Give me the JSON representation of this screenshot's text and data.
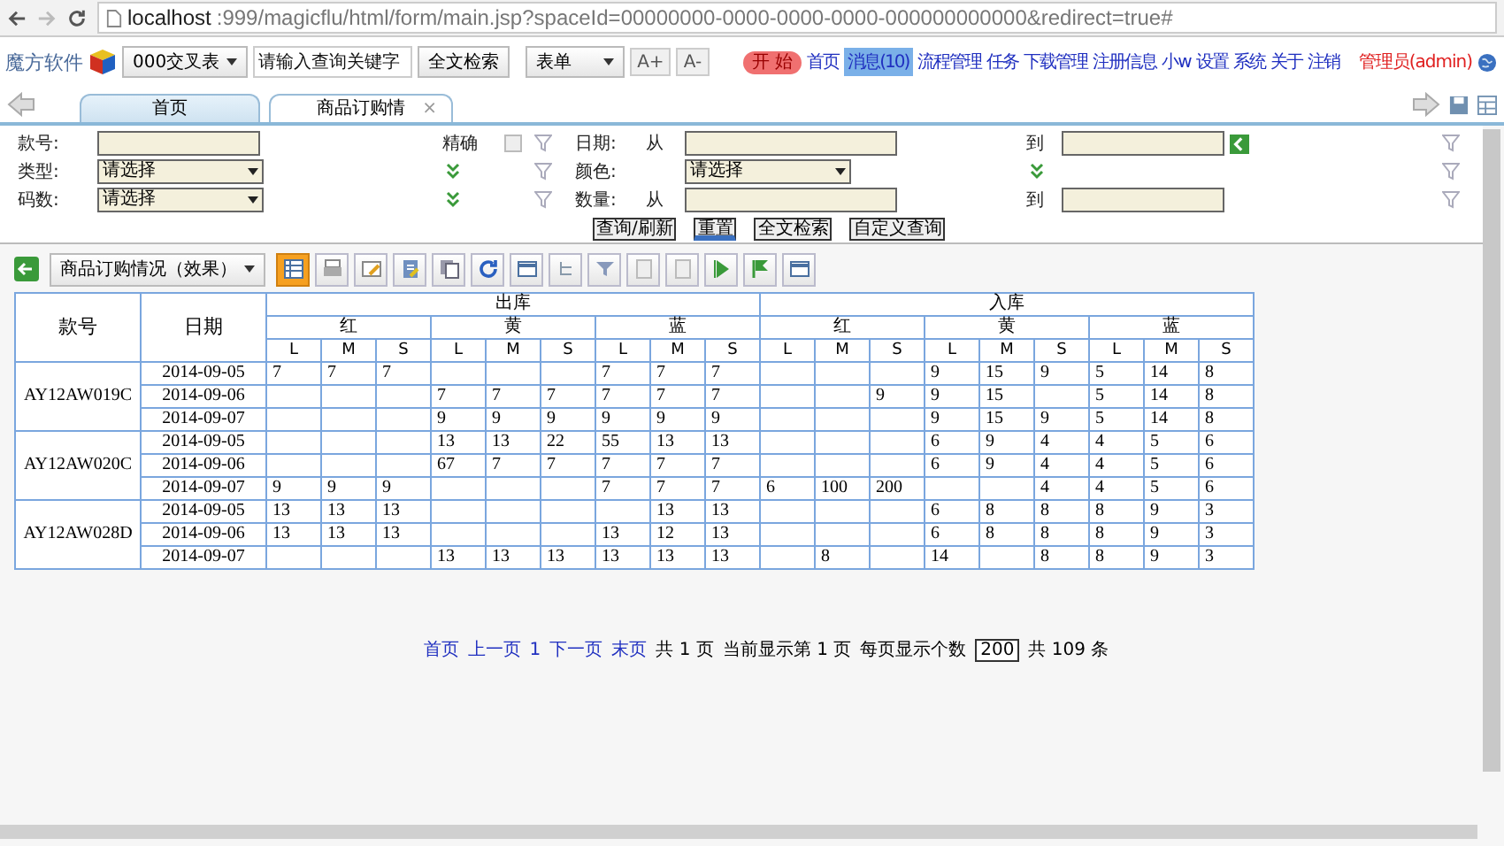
{
  "browser": {
    "host": "localhost",
    "path": ":999/magicflu/html/form/main.jsp?spaceId=00000000-0000-0000-0000-000000000000&redirect=true#"
  },
  "header": {
    "logo": "魔方软件",
    "space_select": "000交叉表",
    "search_placeholder": "请输入查询关键字",
    "search_button": "全文检索",
    "form_select": "表单",
    "font_buttons": [
      "A+",
      "A-"
    ],
    "start_button": "开 始",
    "nav": [
      {
        "label": "首页",
        "highlighted": false
      },
      {
        "label": "消息(10)",
        "highlighted": true
      },
      {
        "label": "流程管理",
        "highlighted": false
      },
      {
        "label": "任务",
        "highlighted": false
      },
      {
        "label": "下载管理",
        "highlighted": false
      },
      {
        "label": "注册信息",
        "highlighted": false
      },
      {
        "label": "小w",
        "highlighted": false
      },
      {
        "label": "设置",
        "highlighted": false
      },
      {
        "label": "系统",
        "highlighted": false
      },
      {
        "label": "关于",
        "highlighted": false
      },
      {
        "label": "注销",
        "highlighted": false
      }
    ],
    "user": "管理员(admin)"
  },
  "tabs": [
    {
      "label": "首页",
      "selected": false
    },
    {
      "label": "商品订购情",
      "selected": true,
      "close": "×"
    }
  ],
  "filters": {
    "code_label": "款号:",
    "exact_label": "精确",
    "exact_checked": false,
    "date_label": "日期:",
    "from": "从",
    "to": "到",
    "type_label": "类型:",
    "type_value": "请选择",
    "color_label": "颜色:",
    "color_value": "请选择",
    "size_label": "码数:",
    "size_value": "请选择",
    "qty_label": "数量:",
    "qty_from": "从",
    "qty_to": "到",
    "buttons": [
      {
        "label": "查询/刷新",
        "selected": false
      },
      {
        "label": "重置",
        "selected": true
      },
      {
        "label": "全文检索",
        "selected": false
      },
      {
        "label": "自定义查询",
        "selected": false
      }
    ]
  },
  "toolbar": {
    "view_select": "商品订购情况（效果）",
    "tools": [
      {
        "kind": "grid",
        "selected": true
      },
      {
        "kind": "print",
        "selected": false
      },
      {
        "kind": "note",
        "selected": false
      },
      {
        "kind": "doc",
        "selected": false
      },
      {
        "kind": "copy",
        "selected": false
      },
      {
        "kind": "refresh",
        "selected": false
      },
      {
        "kind": "window",
        "selected": false
      },
      {
        "kind": "tree",
        "selected": false
      },
      {
        "kind": "funnel",
        "selected": false
      },
      {
        "kind": "blank",
        "selected": false
      },
      {
        "kind": "blank",
        "selected": false
      },
      {
        "kind": "play",
        "selected": false
      },
      {
        "kind": "flag",
        "selected": false
      },
      {
        "kind": "window",
        "selected": false
      }
    ]
  },
  "table": {
    "columns": [
      "款号",
      "日期"
    ],
    "groups": [
      {
        "label": "出库",
        "colors": [
          {
            "label": "红",
            "sizes": [
              "L",
              "M",
              "S"
            ]
          },
          {
            "label": "黄",
            "sizes": [
              "L",
              "M",
              "S"
            ]
          },
          {
            "label": "蓝",
            "sizes": [
              "L",
              "M",
              "S"
            ]
          }
        ]
      },
      {
        "label": "入库",
        "colors": [
          {
            "label": "红",
            "sizes": [
              "L",
              "M",
              "S"
            ]
          },
          {
            "label": "黄",
            "sizes": [
              "L",
              "M",
              "S"
            ]
          },
          {
            "label": "蓝",
            "sizes": [
              "L",
              "M",
              "S"
            ]
          }
        ]
      }
    ],
    "items": [
      {
        "code": "AY12AW019C",
        "dates": [
          {
            "date": "2014-09-05",
            "values": {
              "out_red_L": "7",
              "out_red_M": "7",
              "out_red_S": "7",
              "out_blue_L": "7",
              "out_blue_M": "7",
              "out_blue_S": "7",
              "in_yellow_L": "9",
              "in_yellow_M": "15",
              "in_yellow_S": "9",
              "in_blue_L": "5",
              "in_blue_M": "14",
              "in_blue_S": "8"
            }
          },
          {
            "date": "2014-09-06",
            "values": {
              "out_yellow_L": "7",
              "out_yellow_M": "7",
              "out_yellow_S": "7",
              "out_blue_L": "7",
              "out_blue_M": "7",
              "out_blue_S": "7",
              "in_red_S": "9",
              "in_yellow_L": "9",
              "in_yellow_M": "15",
              "in_blue_L": "5",
              "in_blue_M": "14",
              "in_blue_S": "8"
            }
          },
          {
            "date": "2014-09-07",
            "values": {
              "out_yellow_L": "9",
              "out_yellow_M": "9",
              "out_yellow_S": "9",
              "out_blue_L": "9",
              "out_blue_M": "9",
              "out_blue_S": "9",
              "in_yellow_L": "9",
              "in_yellow_M": "15",
              "in_yellow_S": "9",
              "in_blue_L": "5",
              "in_blue_M": "14",
              "in_blue_S": "8"
            }
          }
        ]
      },
      {
        "code": "AY12AW020C",
        "dates": [
          {
            "date": "2014-09-05",
            "values": {
              "out_yellow_L": "13",
              "out_yellow_M": "13",
              "out_yellow_S": "22",
              "out_blue_L": "55",
              "out_blue_M": "13",
              "out_blue_S": "13",
              "in_yellow_L": "6",
              "in_yellow_M": "9",
              "in_yellow_S": "4",
              "in_blue_L": "4",
              "in_blue_M": "5",
              "in_blue_S": "6"
            }
          },
          {
            "date": "2014-09-06",
            "values": {
              "out_yellow_L": "67",
              "out_yellow_M": "7",
              "out_yellow_S": "7",
              "out_blue_L": "7",
              "out_blue_M": "7",
              "out_blue_S": "7",
              "in_yellow_L": "6",
              "in_yellow_M": "9",
              "in_yellow_S": "4",
              "in_blue_L": "4",
              "in_blue_M": "5",
              "in_blue_S": "6"
            }
          },
          {
            "date": "2014-09-07",
            "values": {
              "out_red_L": "9",
              "out_red_M": "9",
              "out_red_S": "9",
              "out_blue_L": "7",
              "out_blue_M": "7",
              "out_blue_S": "7",
              "in_red_L": "6",
              "in_red_M": "100",
              "in_red_S": "200",
              "in_yellow_S": "4",
              "in_blue_L": "4",
              "in_blue_M": "5",
              "in_blue_S": "6"
            }
          }
        ]
      },
      {
        "code": "AY12AW028D",
        "dates": [
          {
            "date": "2014-09-05",
            "values": {
              "out_red_L": "13",
              "out_red_M": "13",
              "out_red_S": "13",
              "out_blue_M": "13",
              "out_blue_S": "13",
              "in_yellow_L": "6",
              "in_yellow_M": "8",
              "in_yellow_S": "8",
              "in_blue_L": "8",
              "in_blue_M": "9",
              "in_blue_S": "3"
            }
          },
          {
            "date": "2014-09-06",
            "values": {
              "out_red_L": "13",
              "out_red_M": "13",
              "out_red_S": "13",
              "out_blue_L": "13",
              "out_blue_M": "12",
              "out_blue_S": "13",
              "in_yellow_L": "6",
              "in_yellow_M": "8",
              "in_yellow_S": "8",
              "in_blue_L": "8",
              "in_blue_M": "9",
              "in_blue_S": "3"
            }
          },
          {
            "date": "2014-09-07",
            "values": {
              "out_yellow_L": "13",
              "out_yellow_M": "13",
              "out_yellow_S": "13",
              "out_blue_L": "13",
              "out_blue_M": "13",
              "out_blue_S": "13",
              "in_red_M": "8",
              "in_yellow_L": "14",
              "in_yellow_S": "8",
              "in_blue_L": "8",
              "in_blue_M": "9",
              "in_blue_S": "3"
            }
          }
        ]
      }
    ]
  },
  "pager": {
    "links": [
      "首页",
      "上一页",
      "1",
      "下一页",
      "末页"
    ],
    "total_pages": "共 1 页",
    "current": "当前显示第 1 页",
    "per_page_label": "每页显示个数",
    "per_page": "200",
    "total": "共 109 条"
  }
}
